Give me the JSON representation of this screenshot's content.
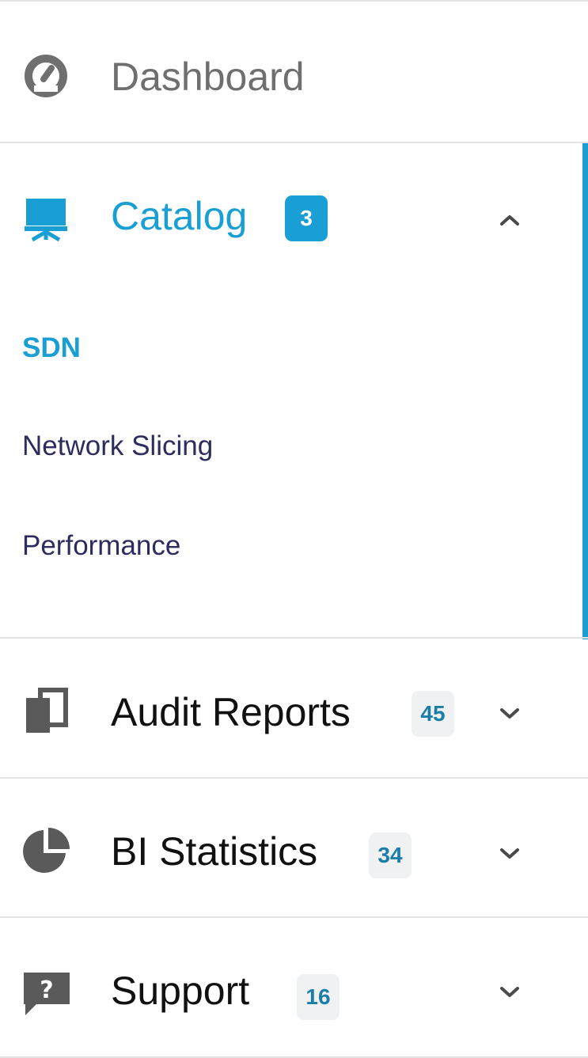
{
  "nav": {
    "dashboard": {
      "label": "Dashboard",
      "icon": "speedometer-icon"
    },
    "catalog": {
      "label": "Catalog",
      "count": "3",
      "icon": "presentation-screen-icon",
      "expanded": true,
      "sub_items": [
        "SDN",
        "Network Slicing",
        "Performance"
      ],
      "selected_sub_item": "SDN"
    },
    "audit_reports": {
      "label": "Audit Reports",
      "count": "45",
      "icon": "copy-documents-icon"
    },
    "bi_statistics": {
      "label": "BI Statistics",
      "count": "34",
      "icon": "pie-chart-icon"
    },
    "support": {
      "label": "Support",
      "count": "16",
      "icon": "question-bubble-icon"
    }
  },
  "colors": {
    "accent": "#1a9fd4",
    "badge_muted_bg": "#f0f1f2",
    "badge_muted_text": "#1a7ea8",
    "sub_item_text": "#2c2c5e",
    "divider": "#e3e3e3"
  }
}
